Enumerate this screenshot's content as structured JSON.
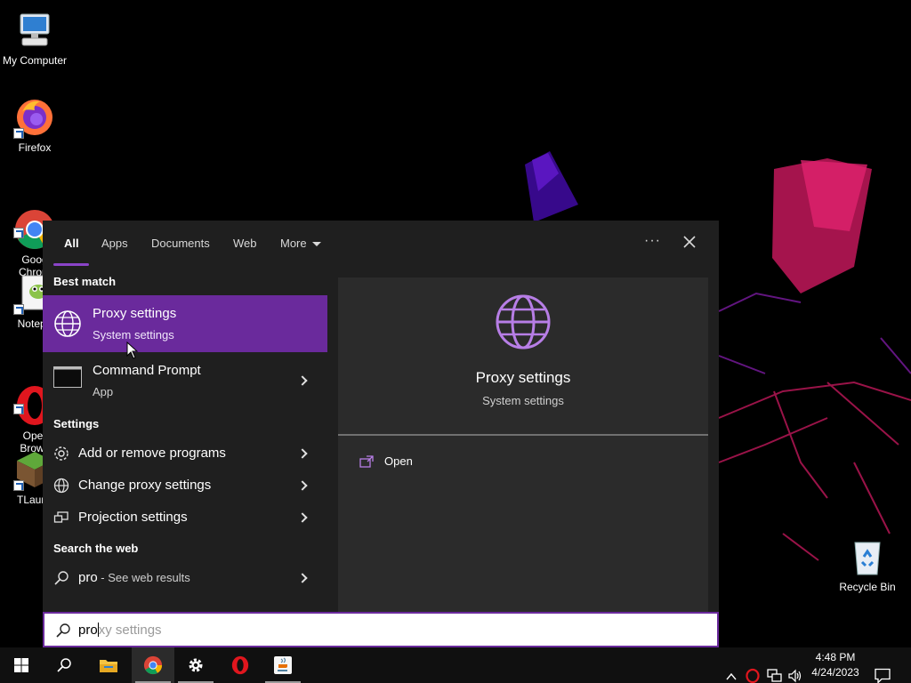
{
  "desktop": {
    "icons": [
      {
        "label": "My Computer"
      },
      {
        "label": "Firefox"
      },
      {
        "label": "Goog\nChrom"
      },
      {
        "label": "Notepa"
      },
      {
        "label": "Oper\nBrows"
      },
      {
        "label": "TLaunc"
      },
      {
        "label": "Recycle Bin"
      }
    ]
  },
  "search_panel": {
    "tabs": [
      {
        "label": "All"
      },
      {
        "label": "Apps"
      },
      {
        "label": "Documents"
      },
      {
        "label": "Web"
      },
      {
        "label": "More"
      }
    ],
    "ellipsis": "···",
    "sections": {
      "best_match": "Best match",
      "settings": "Settings",
      "search_web": "Search the web"
    },
    "best_match": {
      "title": "Proxy settings",
      "subtitle": "System settings"
    },
    "apps": [
      {
        "title": "Command Prompt",
        "subtitle": "App"
      }
    ],
    "settings_items": [
      {
        "label": "Add or remove programs"
      },
      {
        "label": "Change proxy settings"
      },
      {
        "label": "Projection settings"
      }
    ],
    "web_result": {
      "query": "pro",
      "suffix": " - See web results"
    },
    "preview": {
      "title": "Proxy settings",
      "subtitle": "System settings",
      "action": "Open"
    }
  },
  "search_box": {
    "typed": "pro",
    "suggestion": "xy settings"
  },
  "taskbar": {
    "clock_time": "4:48 PM",
    "clock_date": "4/24/2023"
  },
  "colors": {
    "accent": "#6a2a9c",
    "accent_light": "#b77ee6",
    "panel": "#1f1f1f",
    "preview": "#2b2b2b"
  }
}
